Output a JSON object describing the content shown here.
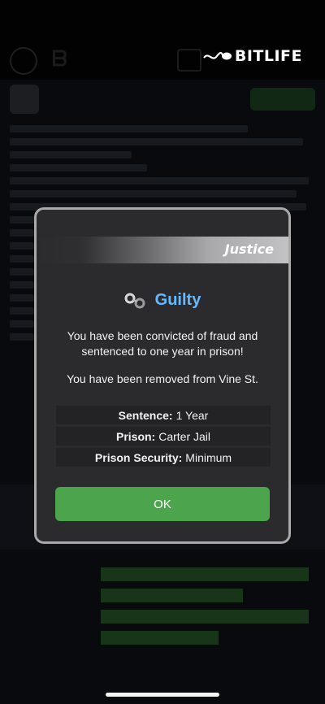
{
  "app": {
    "brand": "BitLife",
    "brand_display": "BITLIFE"
  },
  "modal": {
    "category": "Justice",
    "headline": "Guilty",
    "message": "You have been convicted of fraud and sentenced to one year in prison!",
    "sub_message": "You have been removed from Vine St.",
    "details": [
      {
        "key": "Sentence:",
        "value": "1 Year"
      },
      {
        "key": "Prison:",
        "value": "Carter Jail"
      },
      {
        "key": "Prison Security:",
        "value": "Minimum"
      }
    ],
    "ok_label": "OK",
    "icon": "handcuffs-icon"
  },
  "colors": {
    "accent_blue": "#65b9ff",
    "ok_green": "#4ca54c",
    "modal_bg": "#2b2b2d",
    "modal_border": "#a9a9ab"
  }
}
